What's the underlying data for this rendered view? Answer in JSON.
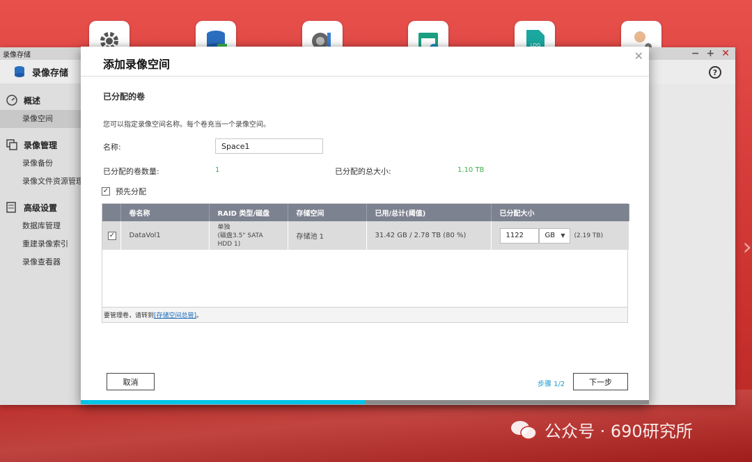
{
  "desktop_icons": [
    {
      "name": "settings-app-icon",
      "color": "#5a5a5a"
    },
    {
      "name": "storage-app-icon",
      "color": "#2a6ec0"
    },
    {
      "name": "tools-app-icon",
      "color": "#3a7fd0"
    },
    {
      "name": "calendar-app-icon",
      "color": "#1aa080"
    },
    {
      "name": "log-app-icon",
      "color": "#1aa8a0"
    },
    {
      "name": "user-app-icon",
      "color": "#c87a40"
    }
  ],
  "app": {
    "window_title": "录像存储",
    "header_title": "录像存储",
    "sidebar": {
      "groups": [
        {
          "label": "概述",
          "icon": "gauge-icon",
          "items": [
            {
              "label": "录像空间",
              "active": true
            }
          ]
        },
        {
          "label": "录像管理",
          "icon": "copy-icon",
          "items": [
            {
              "label": "录像备份"
            },
            {
              "label": "录像文件资源管理"
            }
          ]
        },
        {
          "label": "高级设置",
          "icon": "database-settings-icon",
          "items": [
            {
              "label": "数据库管理"
            },
            {
              "label": "重建录像索引"
            },
            {
              "label": "录像查看器"
            }
          ]
        }
      ]
    }
  },
  "modal": {
    "title": "添加录像空间",
    "section_title": "已分配的卷",
    "description": "您可以指定录像空间名称。每个卷充当一个录像空间。",
    "name_label": "名称:",
    "name_value": "Space1",
    "volume_count_label": "已分配的卷数量:",
    "volume_count_value": "1",
    "total_size_label": "已分配的总大小:",
    "total_size_value": "1.10 TB",
    "preallocate_label": "预先分配",
    "preallocate_checked": true,
    "table": {
      "headers": [
        "卷名称",
        "RAID 类型/磁盘",
        "存储空间",
        "已用/总计(阈值)",
        "已分配大小"
      ],
      "rows": [
        {
          "checked": true,
          "volume_name": "DataVol1",
          "raid_line1": "单独",
          "raid_line2": "(磁盘3.5\" SATA",
          "raid_line3": "HDD 1)",
          "storage_pool": "存储池 1",
          "used_total": "31.42 GB / 2.78 TB (80 %)",
          "alloc_value": "1122",
          "alloc_unit": "GB",
          "alloc_max": "(2.19 TB)"
        }
      ],
      "footer_text": "要管理卷，请转到",
      "footer_link": "[存储空间总管]",
      "footer_end": "。"
    },
    "cancel_label": "取消",
    "step_text": "步骤 1/2",
    "next_label": "下一步",
    "progress": 0.5
  },
  "watermark": "公众号 · 690研究所",
  "colors": {
    "accent": "#00c4e8",
    "success": "#3bb04a",
    "link": "#1a6bbd",
    "header": "#7d8290"
  }
}
